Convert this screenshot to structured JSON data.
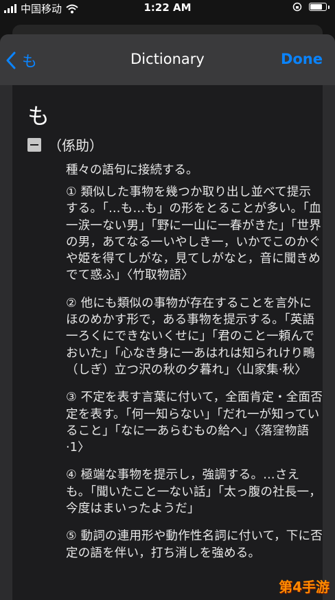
{
  "status_bar": {
    "carrier": "中国移动",
    "time": "1:22 AM"
  },
  "nav": {
    "back_label": "も",
    "title": "Dictionary",
    "done_label": "Done"
  },
  "entry": {
    "headword": "も",
    "part_of_speech": "（係助）",
    "definition": "種々の語句に接続する。",
    "senses": [
      "① 類似した事物を幾つか取り出し並べて提示する。「…も…も」の形をとることが多い。「血一涙一ない男」「野に一山に一春がきた」「世界の男，あてなる一いやしき一，いかでこのかぐや姫を得てしがな，見てしがなと，音に聞きめでて惑ふ」〈竹取物語〉",
      "② 他にも類似の事物が存在することを言外にほのめかす形で，ある事物を提示する。「英語一ろくにできないくせに」「君のこと一頼んでおいた」「心なき身に一あはれは知られけり鴫（しぎ）立つ沢の秋の夕暮れ」〈山家集·秋〉",
      "③ 不定を表す言葉に付いて，全面肯定・全面否定を表す。「何一知らない」「だれ一が知っていること」「なに一あらむもの給へ」〈落窪物語·1〉",
      "④ 極端な事物を提示し，強調する。…さえも。「聞いたこと一ない話」「太っ腹の社長一，今度はまいったようだ」",
      "⑤ 動詞の連用形や動作性名詞に付いて，下に否定の語を伴い，打ち消しを強める。"
    ]
  },
  "watermark": "第4手游"
}
